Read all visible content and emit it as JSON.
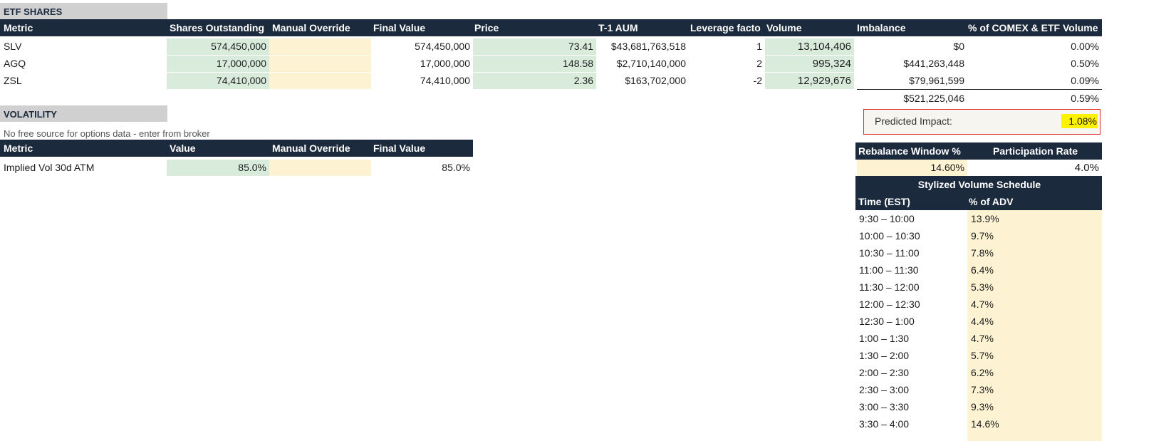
{
  "etf_shares": {
    "section_title": "ETF SHARES",
    "headers": [
      "Metric",
      "Shares Outstanding",
      "Manual Override",
      "Final Value",
      "Price",
      "T-1 AUM",
      "Leverage facto",
      "Volume",
      "Imbalance",
      "% of COMEX & ETF Volume"
    ],
    "rows": [
      {
        "metric": "SLV",
        "shares": "574,450,000",
        "override": "",
        "final": "574,450,000",
        "price": "73.41",
        "aum": "$43,681,763,518",
        "leverage": "1",
        "volume": "13,104,406",
        "imbalance": "$0",
        "pct": "0.00%"
      },
      {
        "metric": "AGQ",
        "shares": "17,000,000",
        "override": "",
        "final": "17,000,000",
        "price": "148.58",
        "aum": "$2,710,140,000",
        "leverage": "2",
        "volume": "995,324",
        "imbalance": "$441,263,448",
        "pct": "0.50%"
      },
      {
        "metric": "ZSL",
        "shares": "74,410,000",
        "override": "",
        "final": "74,410,000",
        "price": "2.36",
        "aum": "$163,702,000",
        "leverage": "-2",
        "volume": "12,929,676",
        "imbalance": "$79,961,599",
        "pct": "0.09%"
      }
    ],
    "total_imbalance": "$521,225,046",
    "total_pct": "0.59%"
  },
  "impact": {
    "label": "Predicted Impact:",
    "value": "1.08%",
    "highlight_color": "#fff200",
    "box_color": "#e0282e"
  },
  "rebalance": {
    "headers": [
      "Rebalance Window %",
      "Participation Rate"
    ],
    "window": "14.60%",
    "participation": "4.0%"
  },
  "schedule": {
    "title": "Stylized Volume Schedule",
    "headers": [
      "Time (EST)",
      "% of ADV"
    ],
    "rows": [
      {
        "time": "9:30 – 10:00",
        "pct": "13.9%"
      },
      {
        "time": "10:00 – 10:30",
        "pct": "9.7%"
      },
      {
        "time": "10:30 – 11:00",
        "pct": "7.8%"
      },
      {
        "time": "11:00 – 11:30",
        "pct": "6.4%"
      },
      {
        "time": "11:30 – 12:00",
        "pct": "5.3%"
      },
      {
        "time": "12:00 – 12:30",
        "pct": "4.7%"
      },
      {
        "time": "12:30 – 1:00",
        "pct": "4.4%"
      },
      {
        "time": "1:00 – 1:30",
        "pct": "4.7%"
      },
      {
        "time": "1:30 – 2:00",
        "pct": "5.7%"
      },
      {
        "time": "2:00 – 2:30",
        "pct": "6.2%"
      },
      {
        "time": "2:30 – 3:00",
        "pct": "7.3%"
      },
      {
        "time": "3:00 – 3:30",
        "pct": "9.3%"
      },
      {
        "time": "3:30 – 4:00",
        "pct": "14.6%"
      }
    ]
  },
  "volatility": {
    "section_title": "VOLATILITY",
    "note": "No free source for options data - enter from broker",
    "headers": [
      "Metric",
      "Value",
      "Manual Override",
      "Final Value"
    ],
    "rows": [
      {
        "metric": "Implied Vol 30d ATM",
        "value": "85.0%",
        "override": "",
        "final": "85.0%"
      }
    ]
  },
  "colors": {
    "header_bg": "#1c2a3e",
    "input_green": "#d9ebdb",
    "override_cream": "#fdf3d2",
    "section_bg": "#d0d0d0"
  }
}
